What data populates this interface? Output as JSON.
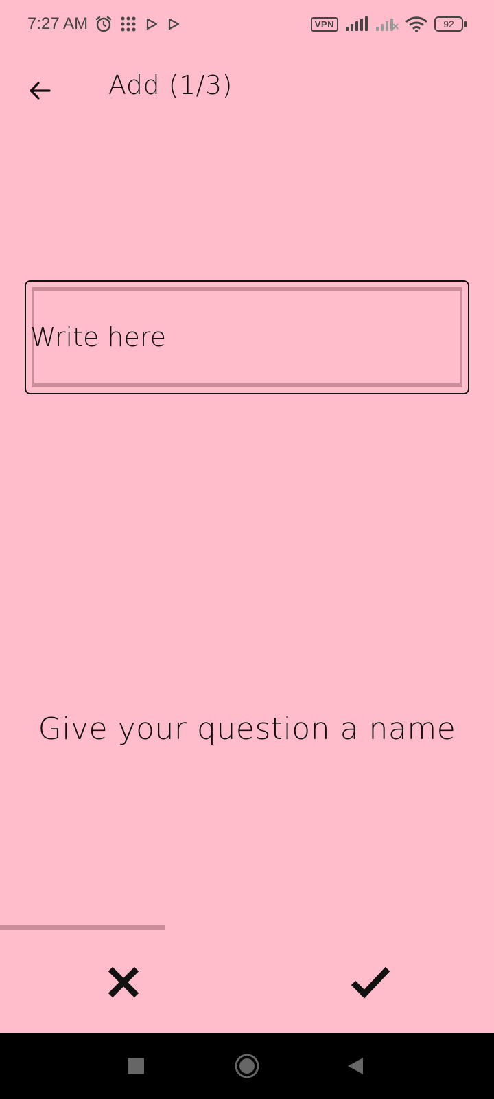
{
  "status_bar": {
    "time": "7:27 AM",
    "icons": [
      "alarm-icon",
      "apps-grid-icon",
      "play-store-icon",
      "play-store-icon",
      "vpn-icon",
      "signal-icon",
      "signal-off-icon",
      "wifi-icon",
      "battery-icon"
    ],
    "vpn_label": "VPN",
    "battery_level": "92"
  },
  "app_bar": {
    "back_icon": "arrow-left-icon",
    "title": "Add (1/3)"
  },
  "form": {
    "input_value": "",
    "input_placeholder": "Write here",
    "prompt": "Give your question a name"
  },
  "progress": {
    "step": 1,
    "total": 3,
    "fraction": 0.333
  },
  "actions": {
    "cancel_icon": "close-icon",
    "confirm_icon": "check-icon"
  },
  "navigation": {
    "icons": [
      "recent-apps-icon",
      "home-icon",
      "back-icon"
    ]
  },
  "colors": {
    "background": "#ffbccb",
    "accent": "#c98e99",
    "text": "#111111",
    "navbar": "#000000"
  }
}
